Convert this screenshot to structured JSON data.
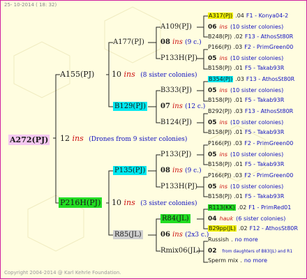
{
  "header": {
    "date": "25- 10-2014 ( 18: 32)",
    "copyright": "Copyright 2004-2014 @ Karl Kehrle Foundation."
  },
  "colors": {
    "pink": "#f4c8f0",
    "cyan": "#00e8f0",
    "green": "#22dd22",
    "yellow": "#f0f000",
    "gray": "#d0d0d0",
    "border": "#d020a0"
  },
  "root": {
    "name": "A272(PJ)",
    "ins_num": "12",
    "ins": "ins",
    "note": "(Drones from 9 sister colonies)"
  },
  "gen1": [
    {
      "name": "A155(PJ)",
      "ins_num": "10",
      "ins": "ins",
      "note": "(8 sister colonies)"
    },
    {
      "name": "P216H(PJ)",
      "ins_num": "10",
      "ins": "ins",
      "note": "(3 sister colonies)"
    }
  ],
  "gen2": [
    {
      "name": "A177(PJ)",
      "ins_num": "08",
      "ins": "ins",
      "note": "(9 c.)"
    },
    {
      "name": "B129(PJ)",
      "ins_num": "07",
      "ins": "ins",
      "note": "(12 c.)"
    },
    {
      "name": "P135(PJ)",
      "ins_num": "08",
      "ins": "ins",
      "note": "(9 c.)"
    },
    {
      "name": "R85(JL)",
      "ins_num": "06",
      "ins": "ins",
      "note": "(2x3 c.)"
    }
  ],
  "gen3": [
    {
      "name": "A109(PJ)",
      "ins_num": "06",
      "ins": "ins",
      "note": "(10 sister colonies)",
      "top": {
        "name": "A317(PJ)",
        "year": ".04",
        "label": "F1 - Konya04-2"
      },
      "bottom": {
        "name": "B248(PJ)",
        "year": ".02",
        "label": "F13 - AthosSt80R"
      }
    },
    {
      "name": "P133H(PJ)",
      "ins_num": "05",
      "ins": "ins",
      "note": "(10 sister colonies)",
      "top": {
        "name": "P166(PJ)",
        "year": ".03",
        "label": "F2 - PrimGreen00"
      },
      "bottom": {
        "name": "B158(PJ)",
        "year": ".01",
        "label": "F5 - Takab93R"
      }
    },
    {
      "name": "B333(PJ)",
      "ins_num": "05",
      "ins": "ins",
      "note": "(10 sister colonies)",
      "top": {
        "name": "B354(PJ)",
        "year": ".03",
        "label": "F13 - AthosSt80R"
      },
      "bottom": {
        "name": "B158(PJ)",
        "year": ".01",
        "label": "F5 - Takab93R"
      }
    },
    {
      "name": "B124(PJ)",
      "ins_num": "05",
      "ins": "ins",
      "note": "(10 sister colonies)",
      "top": {
        "name": "B292(PJ)",
        "year": ".03",
        "label": "F13 - AthosSt80R"
      },
      "bottom": {
        "name": "B158(PJ)",
        "year": ".01",
        "label": "F5 - Takab93R"
      }
    },
    {
      "name": "P133(PJ)",
      "ins_num": "05",
      "ins": "ins",
      "note": "(10 sister colonies)",
      "top": {
        "name": "P166(PJ)",
        "year": ".03",
        "label": "F2 - PrimGreen00"
      },
      "bottom": {
        "name": "B158(PJ)",
        "year": ".01",
        "label": "F5 - Takab93R"
      }
    },
    {
      "name": "P133H(PJ)",
      "ins_num": "05",
      "ins": "ins",
      "note": "(10 sister colonies)",
      "top": {
        "name": "P166(PJ)",
        "year": ".03",
        "label": "F2 - PrimGreen00"
      },
      "bottom": {
        "name": "B158(PJ)",
        "year": ".01",
        "label": "F5 - Takab93R"
      }
    },
    {
      "name": "R84(JL)",
      "ins_num": "04",
      "ins": "hauk",
      "note": "(6 sister colonies)",
      "top": {
        "name": "R113(KK)",
        "year": ".02",
        "label": "F1 - PrimRed01"
      },
      "bottom": {
        "name": "B29pp(JL)",
        "year": ".02",
        "label": "F12 - AthosSt80R"
      }
    },
    {
      "name": "Rmix06(JL)",
      "ins_num": "02",
      "ins": "",
      "note": "from daughters of B83(JL) and R1",
      "top": {
        "name": "Russish",
        "year": ".",
        "label": "no more"
      },
      "bottom": {
        "name": "Sperm mix",
        "year": ".",
        "label": "no more"
      }
    }
  ]
}
